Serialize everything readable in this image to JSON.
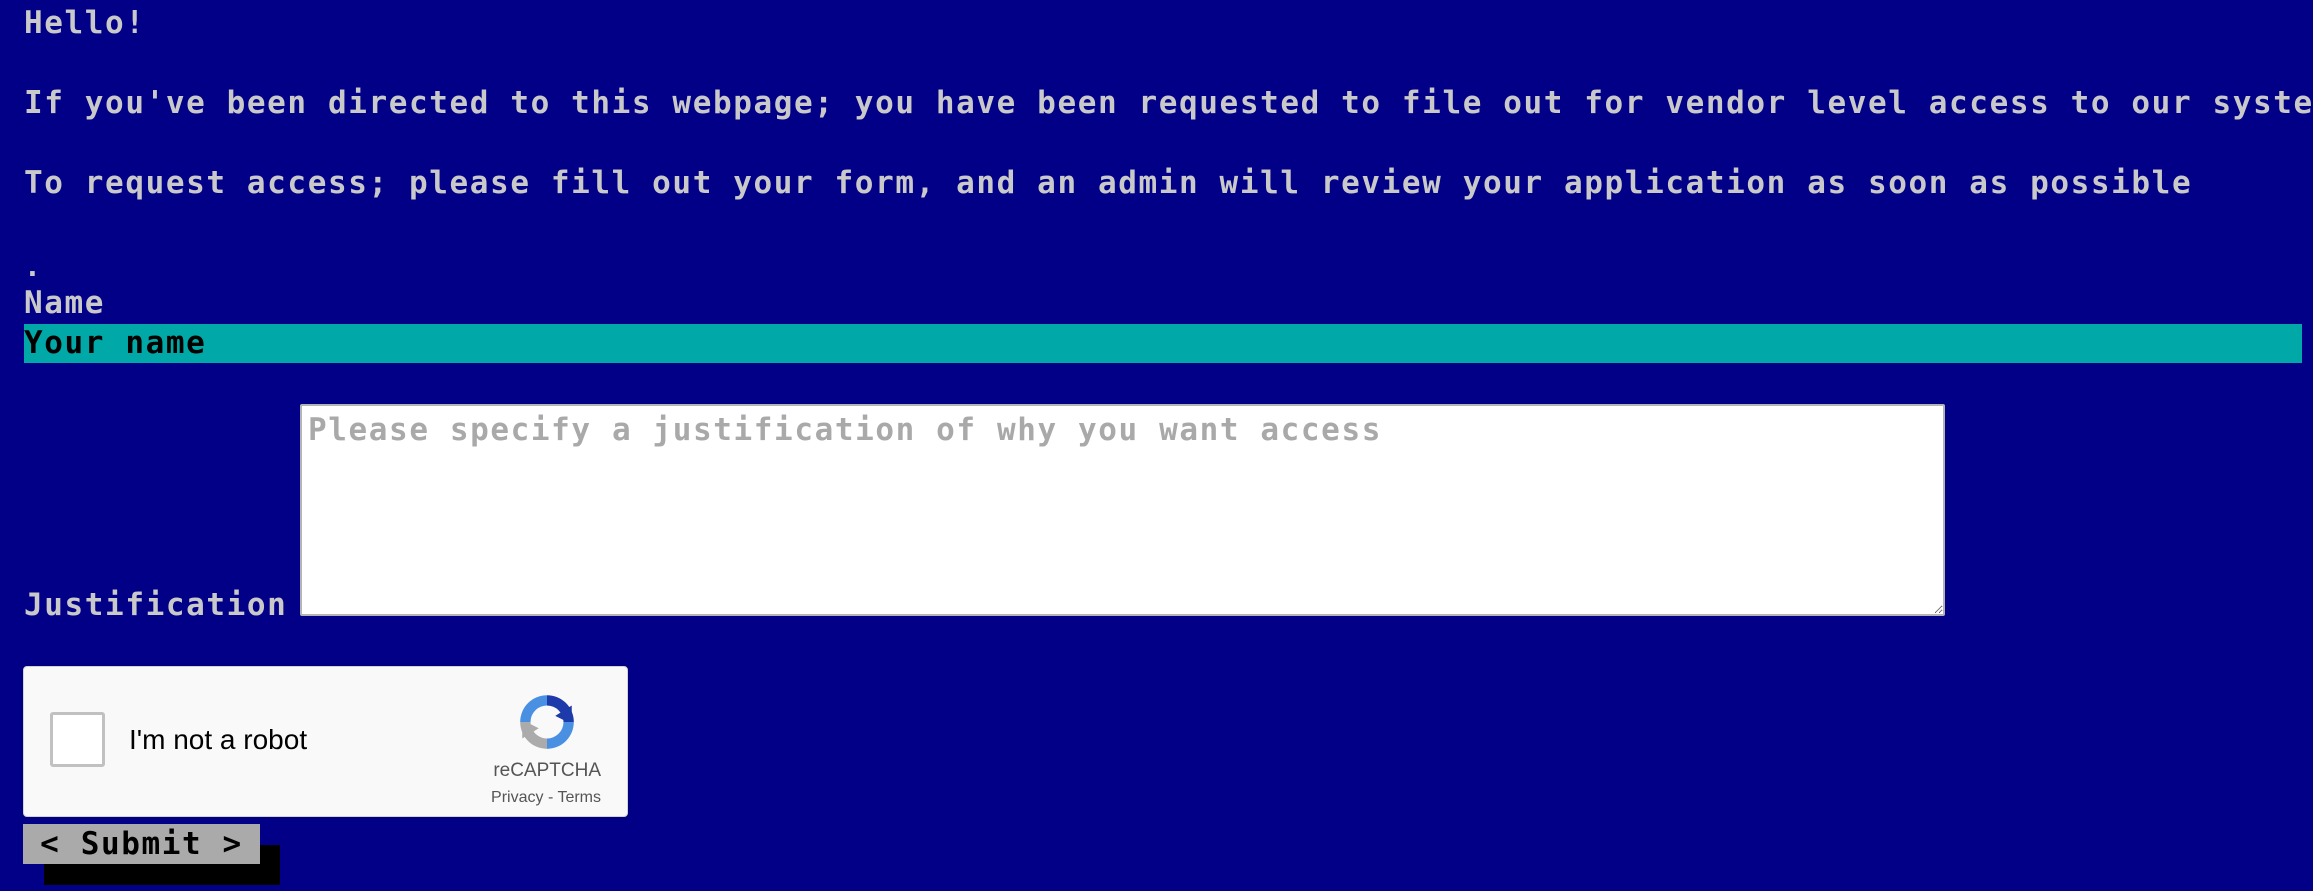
{
  "colors": {
    "background": "#020087",
    "text": "#c9c9c9",
    "name_field_bg": "#00a8a8",
    "submit_bg": "#aaaaaa",
    "submit_shadow": "#000000"
  },
  "content": {
    "greeting": "Hello!",
    "intro": "If you've been directed to this webpage; you have been requested to file out for vendor level access to our system.",
    "instructions": "To request access; please fill out your form, and an admin will review your application as soon as possible",
    "separator": "."
  },
  "form": {
    "name": {
      "label": "Name",
      "value": "",
      "placeholder": "Your name"
    },
    "justification": {
      "label": "Justification",
      "value": "",
      "placeholder": "Please specify a justification of why you want access"
    },
    "captcha": {
      "checkbox_label": "I'm not a robot",
      "checked": false,
      "brand": "reCAPTCHA",
      "privacy_link": "Privacy",
      "link_separator": "-",
      "terms_link": "Terms",
      "icon": "recaptcha-logo-icon"
    },
    "submit": {
      "label": "< Submit >"
    }
  }
}
